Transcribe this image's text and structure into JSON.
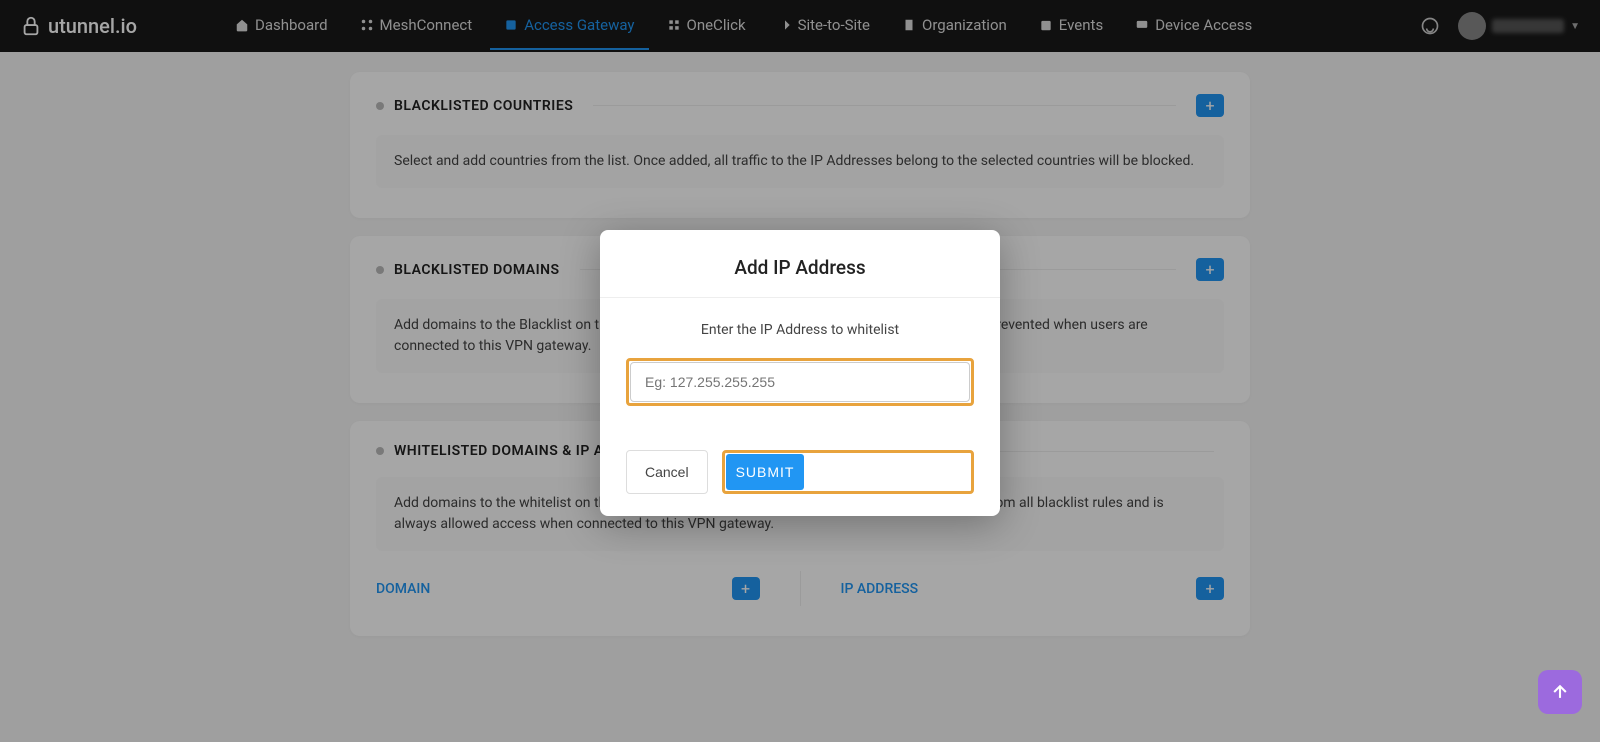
{
  "brand": "utunnel.io",
  "nav": {
    "dashboard": "Dashboard",
    "meshconnect": "MeshConnect",
    "access_gateway": "Access Gateway",
    "oneclick": "OneClick",
    "site_to_site": "Site-to-Site",
    "organization": "Organization",
    "events": "Events",
    "device_access": "Device Access"
  },
  "sections": {
    "blacklisted_countries": {
      "title": "BLACKLISTED COUNTRIES",
      "body": "Select and add countries from the list. Once added, all traffic to the IP Addresses belong to the selected countries will be blocked."
    },
    "blacklisted_domains": {
      "title": "BLACKLISTED DOMAINS",
      "body": "Add domains to the Blacklist on this VPN gateway. Once listed, access to these domains will be prevented when users are connected to this VPN gateway."
    },
    "whitelisted": {
      "title": "WHITELISTED DOMAINS & IP ADDRESSES",
      "body": "Add domains to the whitelist on this VPN gateway. Once listed, the domains would be excluded from all blacklist rules and is always allowed access when connected to this VPN gateway.",
      "domain_label": "DOMAIN",
      "ip_label": "IP ADDRESS"
    }
  },
  "modal": {
    "title": "Add IP Address",
    "subtitle": "Enter the IP Address to whitelist",
    "placeholder": "Eg: 127.255.255.255",
    "cancel": "Cancel",
    "submit": "SUBMIT"
  }
}
